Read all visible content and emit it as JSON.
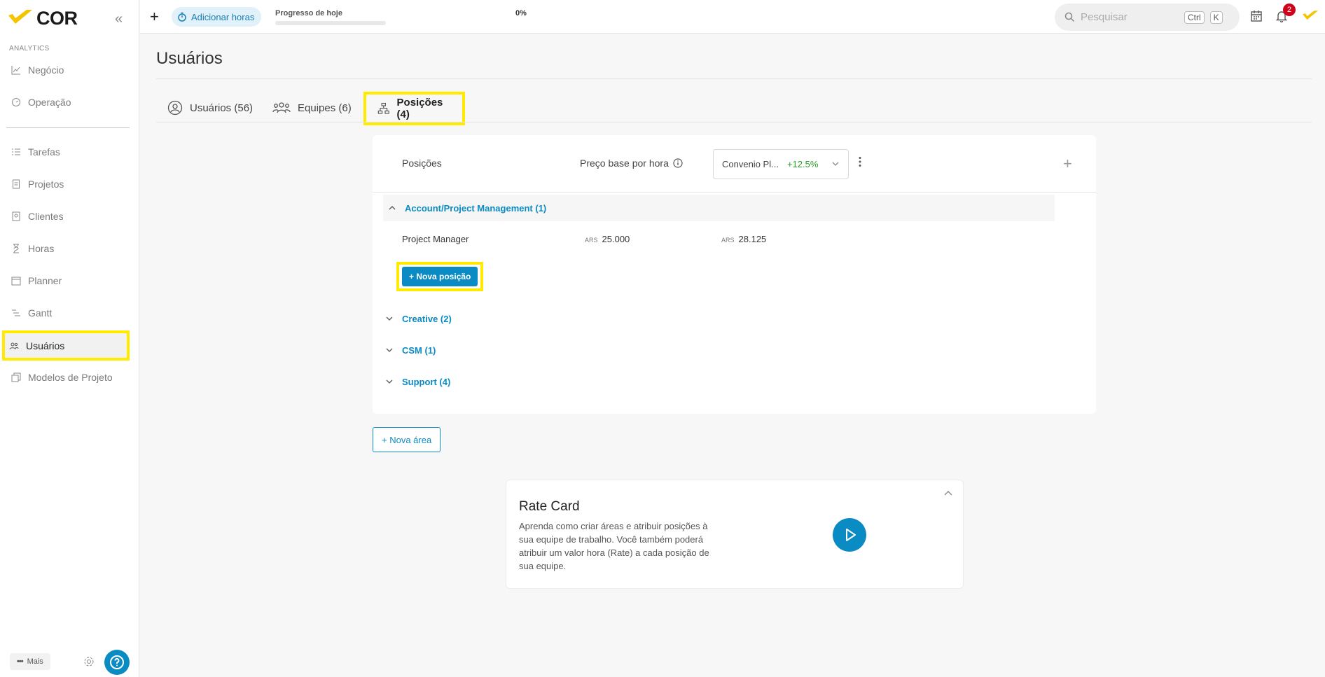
{
  "app": {
    "logo": "COR"
  },
  "sidebar": {
    "section_label": "ANALYTICS",
    "items": [
      {
        "label": "Negócio",
        "icon": "chart-line-icon"
      },
      {
        "label": "Operação",
        "icon": "gauge-icon"
      },
      {
        "label": "Tarefas",
        "icon": "list-check-icon"
      },
      {
        "label": "Projetos",
        "icon": "document-icon"
      },
      {
        "label": "Clientes",
        "icon": "contact-card-icon"
      },
      {
        "label": "Horas",
        "icon": "hourglass-icon"
      },
      {
        "label": "Planner",
        "icon": "calendar-edit-icon"
      },
      {
        "label": "Gantt",
        "icon": "gantt-icon"
      },
      {
        "label": "Usuários",
        "icon": "users-icon",
        "active": true
      },
      {
        "label": "Modelos de Projeto",
        "icon": "copy-icon"
      }
    ],
    "more_label": "Mais"
  },
  "topbar": {
    "add_hours_label": "Adicionar horas",
    "progress_label": "Progresso de hoje",
    "progress_pct": "0%",
    "progress_value": 0,
    "search_placeholder": "Pesquisar",
    "kbd_ctrl": "Ctrl",
    "kbd_k": "K",
    "notification_count": "2"
  },
  "page": {
    "title": "Usuários",
    "tabs": [
      {
        "label": "Usuários (56)"
      },
      {
        "label": "Equipes (6)"
      },
      {
        "label": "Posições (4)",
        "active": true
      }
    ]
  },
  "positions": {
    "header_positions": "Posições",
    "header_price": "Preço base por hora",
    "convenio_label": "Convenio Pl...",
    "convenio_pct": "+12.5%",
    "groups": [
      {
        "label": "Account/Project Management (1)",
        "open": true
      },
      {
        "label": "Creative (2)"
      },
      {
        "label": "CSM (1)"
      },
      {
        "label": "Support (4)"
      }
    ],
    "rows": [
      {
        "name": "Project Manager",
        "currency": "ARS",
        "base": "25.000",
        "converted_currency": "ARS",
        "converted": "28.125"
      }
    ],
    "new_position_label": "+ Nova posição"
  },
  "new_area_label": "+ Nova área",
  "rate_card": {
    "title": "Rate Card",
    "description": "Aprenda como criar áreas e atribuir posições à sua equipe de trabalho. Você também poderá atribuir um valor hora (Rate) a cada posição de sua equipe."
  },
  "colors": {
    "accent": "#0a8bc4",
    "highlight": "#ffea00",
    "brand": "#f5c400",
    "positive": "#2a9d2a",
    "badge": "#d0021b"
  }
}
